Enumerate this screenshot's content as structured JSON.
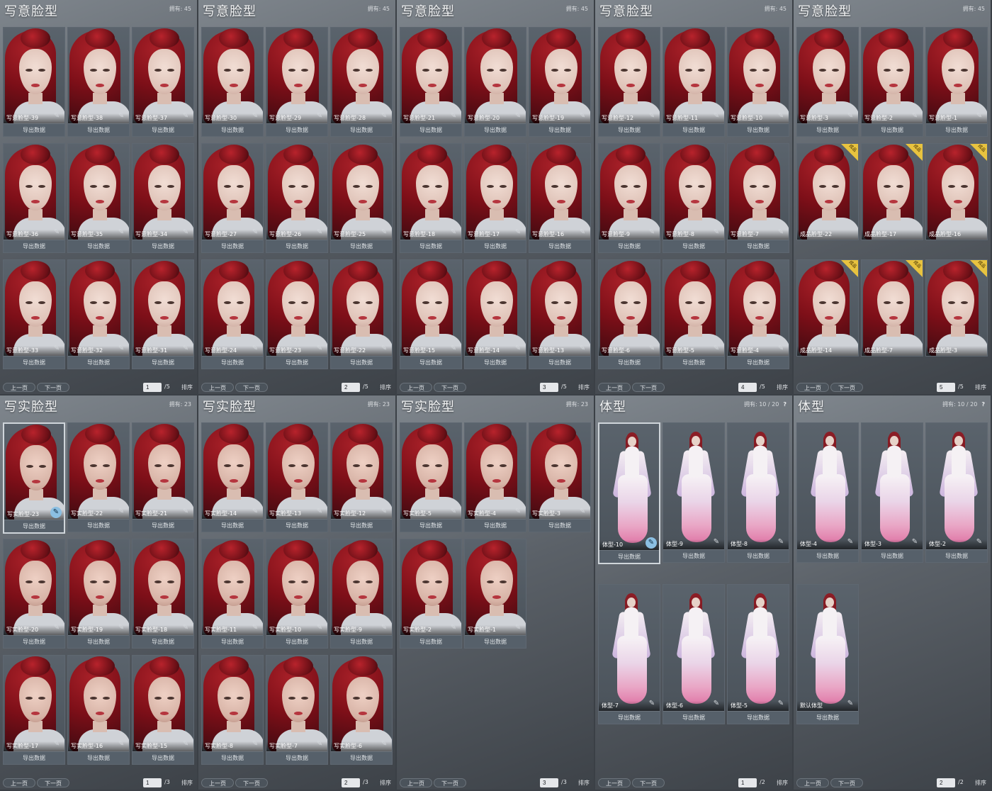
{
  "panels": [
    {
      "title": "写意脸型",
      "count": "拥有: 45",
      "page": "1",
      "total": "/5",
      "prev": "上一页",
      "next": "下一页",
      "sort": "排序",
      "kind": "face",
      "cards": [
        {
          "label": "写意脸型-39",
          "btn": "导出数据"
        },
        {
          "label": "写意脸型-38",
          "btn": "导出数据"
        },
        {
          "label": "写意脸型-37",
          "btn": "导出数据"
        },
        {
          "label": "写意脸型-36",
          "btn": "导出数据"
        },
        {
          "label": "写意脸型-35",
          "btn": "导出数据"
        },
        {
          "label": "写意脸型-34",
          "btn": "导出数据"
        },
        {
          "label": "写意脸型-33",
          "btn": "导出数据"
        },
        {
          "label": "写意脸型-32",
          "btn": "导出数据"
        },
        {
          "label": "写意脸型-31",
          "btn": "导出数据"
        }
      ]
    },
    {
      "title": "写意脸型",
      "count": "拥有: 45",
      "page": "2",
      "total": "/5",
      "prev": "上一页",
      "next": "下一页",
      "sort": "排序",
      "kind": "face",
      "cards": [
        {
          "label": "写意脸型-30",
          "btn": "导出数据"
        },
        {
          "label": "写意脸型-29",
          "btn": "导出数据"
        },
        {
          "label": "写意脸型-28",
          "btn": "导出数据"
        },
        {
          "label": "写意脸型-27",
          "btn": "导出数据"
        },
        {
          "label": "写意脸型-26",
          "btn": "导出数据"
        },
        {
          "label": "写意脸型-25",
          "btn": "导出数据"
        },
        {
          "label": "写意脸型-24",
          "btn": "导出数据"
        },
        {
          "label": "写意脸型-23",
          "btn": "导出数据"
        },
        {
          "label": "写意脸型-22",
          "btn": "导出数据"
        }
      ]
    },
    {
      "title": "写意脸型",
      "count": "拥有: 45",
      "page": "3",
      "total": "/5",
      "prev": "上一页",
      "next": "下一页",
      "sort": "排序",
      "kind": "face",
      "cards": [
        {
          "label": "写意脸型-21",
          "btn": "导出数据"
        },
        {
          "label": "写意脸型-20",
          "btn": "导出数据"
        },
        {
          "label": "写意脸型-19",
          "btn": "导出数据"
        },
        {
          "label": "写意脸型-18",
          "btn": "导出数据"
        },
        {
          "label": "写意脸型-17",
          "btn": "导出数据"
        },
        {
          "label": "写意脸型-16",
          "btn": "导出数据"
        },
        {
          "label": "写意脸型-15",
          "btn": "导出数据"
        },
        {
          "label": "写意脸型-14",
          "btn": "导出数据"
        },
        {
          "label": "写意脸型-13",
          "btn": "导出数据"
        }
      ]
    },
    {
      "title": "写意脸型",
      "count": "拥有: 45",
      "page": "4",
      "total": "/5",
      "prev": "上一页",
      "next": "下一页",
      "sort": "排序",
      "kind": "face",
      "cards": [
        {
          "label": "写意脸型-12",
          "btn": "导出数据"
        },
        {
          "label": "写意脸型-11",
          "btn": "导出数据"
        },
        {
          "label": "写意脸型-10",
          "btn": "导出数据"
        },
        {
          "label": "写意脸型-9",
          "btn": "导出数据"
        },
        {
          "label": "写意脸型-8",
          "btn": "导出数据"
        },
        {
          "label": "写意脸型-7",
          "btn": "导出数据"
        },
        {
          "label": "写意脸型-6",
          "btn": "导出数据"
        },
        {
          "label": "写意脸型-5",
          "btn": "导出数据"
        },
        {
          "label": "写意脸型-4",
          "btn": "导出数据"
        }
      ]
    },
    {
      "title": "写意脸型",
      "count": "拥有: 45",
      "page": "5",
      "total": "/5",
      "prev": "上一页",
      "next": "下一页",
      "sort": "排序",
      "kind": "face",
      "cards": [
        {
          "label": "写意脸型-3",
          "btn": "导出数据"
        },
        {
          "label": "写意脸型-2",
          "btn": "导出数据"
        },
        {
          "label": "写意脸型-1",
          "btn": "导出数据"
        },
        {
          "label": "成品脸型-22",
          "btn": "",
          "tag": "成品"
        },
        {
          "label": "成品脸型-17",
          "btn": "",
          "tag": "成品"
        },
        {
          "label": "成品脸型-16",
          "btn": "",
          "tag": "成品"
        },
        {
          "label": "成品脸型-14",
          "btn": "",
          "tag": "成品"
        },
        {
          "label": "成品脸型-7",
          "btn": "",
          "tag": "成品"
        },
        {
          "label": "成品脸型-3",
          "btn": "",
          "tag": "成品"
        }
      ]
    },
    {
      "title": "写实脸型",
      "count": "拥有: 23",
      "page": "1",
      "total": "/3",
      "prev": "上一页",
      "next": "下一页",
      "sort": "排序",
      "kind": "face",
      "realistic": true,
      "cards": [
        {
          "label": "写实脸型-23",
          "btn": "导出数据",
          "selected": true
        },
        {
          "label": "写实脸型-22",
          "btn": "导出数据"
        },
        {
          "label": "写实脸型-21",
          "btn": "导出数据"
        },
        {
          "label": "写实脸型-20",
          "btn": "导出数据"
        },
        {
          "label": "写实脸型-19",
          "btn": "导出数据"
        },
        {
          "label": "写实脸型-18",
          "btn": "导出数据"
        },
        {
          "label": "写实脸型-17",
          "btn": "导出数据"
        },
        {
          "label": "写实脸型-16",
          "btn": "导出数据"
        },
        {
          "label": "写实脸型-15",
          "btn": "导出数据"
        }
      ]
    },
    {
      "title": "写实脸型",
      "count": "拥有: 23",
      "page": "2",
      "total": "/3",
      "prev": "上一页",
      "next": "下一页",
      "sort": "排序",
      "kind": "face",
      "realistic": true,
      "cards": [
        {
          "label": "写实脸型-14",
          "btn": "导出数据"
        },
        {
          "label": "写实脸型-13",
          "btn": "导出数据"
        },
        {
          "label": "写实脸型-12",
          "btn": "导出数据"
        },
        {
          "label": "写实脸型-11",
          "btn": "导出数据"
        },
        {
          "label": "写实脸型-10",
          "btn": "导出数据"
        },
        {
          "label": "写实脸型-9",
          "btn": "导出数据"
        },
        {
          "label": "写实脸型-8",
          "btn": "导出数据"
        },
        {
          "label": "写实脸型-7",
          "btn": "导出数据"
        },
        {
          "label": "写实脸型-6",
          "btn": "导出数据"
        }
      ]
    },
    {
      "title": "写实脸型",
      "count": "拥有: 23",
      "page": "3",
      "total": "/3",
      "prev": "上一页",
      "next": "下一页",
      "sort": "排序",
      "kind": "face",
      "realistic": true,
      "cards": [
        {
          "label": "写实脸型-5",
          "btn": "导出数据"
        },
        {
          "label": "写实脸型-4",
          "btn": "导出数据"
        },
        {
          "label": "写实脸型-3",
          "btn": "导出数据"
        },
        {
          "label": "写实脸型-2",
          "btn": "导出数据"
        },
        {
          "label": "写实脸型-1",
          "btn": "导出数据"
        }
      ]
    },
    {
      "title": "体型",
      "count": "拥有: 10 / 20",
      "help": "?",
      "page": "1",
      "total": "/2",
      "prev": "上一页",
      "next": "下一页",
      "sort": "排序",
      "kind": "body",
      "cards": [
        {
          "label": "体型-10",
          "btn": "导出数据",
          "selected": true
        },
        {
          "label": "体型-9",
          "btn": "导出数据"
        },
        {
          "label": "体型-8",
          "btn": "导出数据"
        },
        {
          "label": "体型-7",
          "btn": "导出数据"
        },
        {
          "label": "体型-6",
          "btn": "导出数据"
        },
        {
          "label": "体型-5",
          "btn": "导出数据"
        }
      ]
    },
    {
      "title": "体型",
      "count": "拥有: 10 / 20",
      "help": "?",
      "page": "2",
      "total": "/2",
      "prev": "上一页",
      "next": "下一页",
      "sort": "排序",
      "kind": "body",
      "cards": [
        {
          "label": "体型-4",
          "btn": "导出数据"
        },
        {
          "label": "体型-3",
          "btn": "导出数据"
        },
        {
          "label": "体型-2",
          "btn": "导出数据"
        },
        {
          "label": "默认体型",
          "btn": "导出数据"
        }
      ]
    }
  ]
}
